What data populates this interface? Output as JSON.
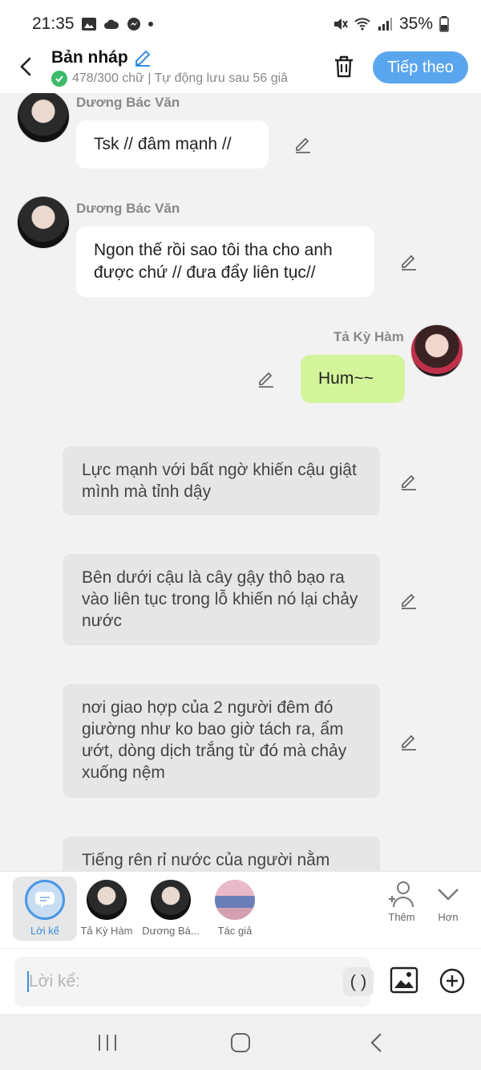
{
  "status_bar": {
    "time": "21:35",
    "battery": "35%"
  },
  "header": {
    "title": "Bản nháp",
    "subtitle": "478/300 chữ | Tự động lưu sau 56 giâ",
    "next_label": "Tiếp theo"
  },
  "messages": [
    {
      "speaker": "Dương Bác Văn",
      "text": "Tsk // đâm mạnh //"
    },
    {
      "speaker": "Dương Bác Văn",
      "text": "Ngon thế rồi sao tôi tha cho anh được chứ // đưa đẩy liên tục//"
    },
    {
      "speaker": "Tả Kỳ Hàm",
      "text": "Hum~~"
    }
  ],
  "narrations": [
    "Lực mạnh với bất ngờ khiến cậu giật mình mà tỉnh dậy",
    "Bên dưới cậu là cây gậy thô bạo ra vào liên tục trong lỗ khiến nó lại chảy nước",
    "nơi giao hợp của 2 người đêm đó giường như ko bao giờ tách ra, ẩm ướt, dòng dịch trắng từ đó mà chảy xuống nệm",
    "Tiếng rên rỉ nước của người nằm"
  ],
  "characters": [
    {
      "label": "Lời kể",
      "selected": true
    },
    {
      "label": "Tả Kỳ Hàm"
    },
    {
      "label": "Dương Bá..."
    },
    {
      "label": "Tác giả"
    }
  ],
  "actions": {
    "add_label": "Thêm",
    "more_label": "Hơn"
  },
  "input": {
    "placeholder": "Lời kể:",
    "paren_label": "( )"
  },
  "colors": {
    "accent": "#5aa6ee",
    "user_bubble": "#d4f49b",
    "narration_bg": "#e6e6e6"
  }
}
